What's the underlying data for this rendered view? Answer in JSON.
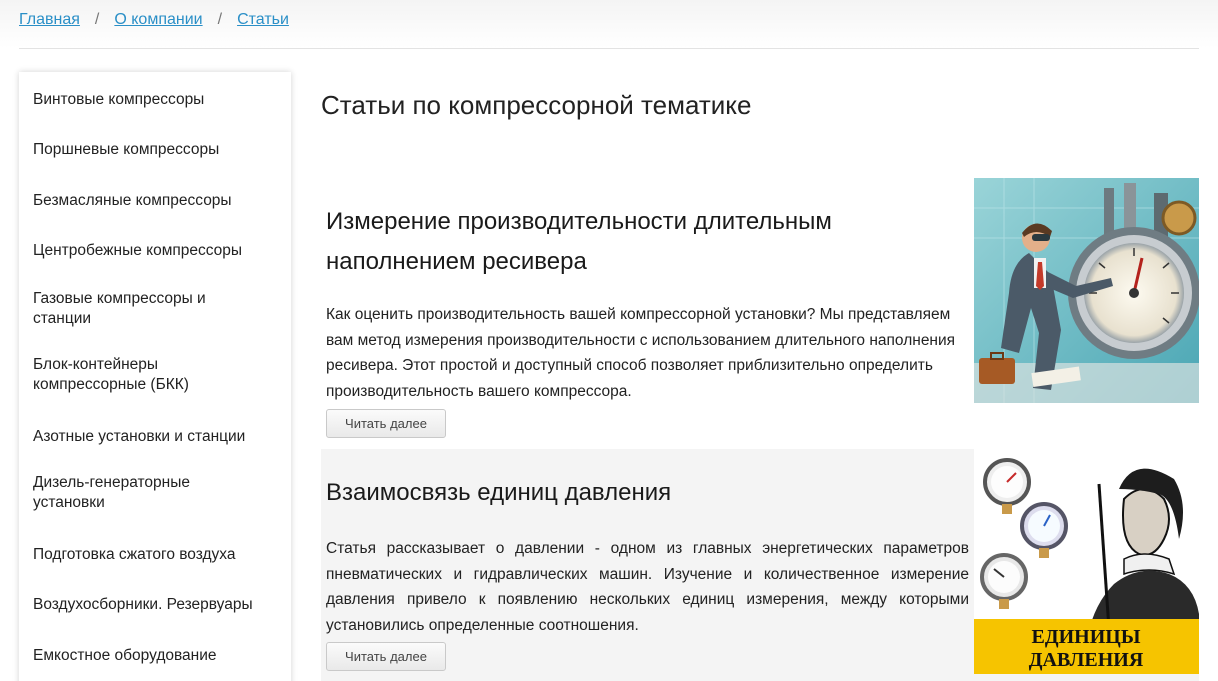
{
  "breadcrumb": {
    "items": [
      "Главная",
      "О компании",
      "Статьи"
    ],
    "separator": "/"
  },
  "sidebar": {
    "items": [
      {
        "label": "Винтовые компрессоры"
      },
      {
        "label": "Поршневые компрессоры"
      },
      {
        "label": "Безмасляные компрессоры"
      },
      {
        "label": "Центробежные компрессоры"
      },
      {
        "label": "Газовые компрессоры и станции"
      },
      {
        "label": "Блок-контейнеры компрессорные (БКК)"
      },
      {
        "label": "Азотные установки и станции"
      },
      {
        "label": "Дизель-генераторные установки"
      },
      {
        "label": "Подготовка сжатого воздуха"
      },
      {
        "label": "Воздухосборники. Резервуары"
      },
      {
        "label": "Емкостное оборудование"
      }
    ]
  },
  "page_title": "Статьи по компрессорной тематике",
  "articles": [
    {
      "title": "Измерение производительности длительным наполнением ресивера",
      "text": "Как оценить производительность вашей компрессорной установки? Мы представляем вам метод измерения производительности с использованием длительного наполнения ресивера. Этот простой и доступный способ позволяет приблизительно определить производительность вашего компрессора.",
      "button": "Читать далее",
      "image_icon": "engineer-pressure-gauge-illustration"
    },
    {
      "title": "Взаимосвязь единиц давления",
      "text": "Статья рассказывает о давлении - одном из главных энергетических параметров пневматических и гидравлических машин. Изучение и количественное измерение давления привело к появлению нескольких единиц измерения, между которыми установились определенные соотношения.",
      "button": "Читать далее",
      "image_icon": "pressure-gauges-illustration",
      "image_caption": [
        "ЕДИНИЦЫ",
        "ДАВЛЕНИЯ"
      ]
    }
  ],
  "colors": {
    "link": "#2a8fc7",
    "banner_yellow": "#f6c400",
    "alt_background": "#f4f4f4"
  }
}
